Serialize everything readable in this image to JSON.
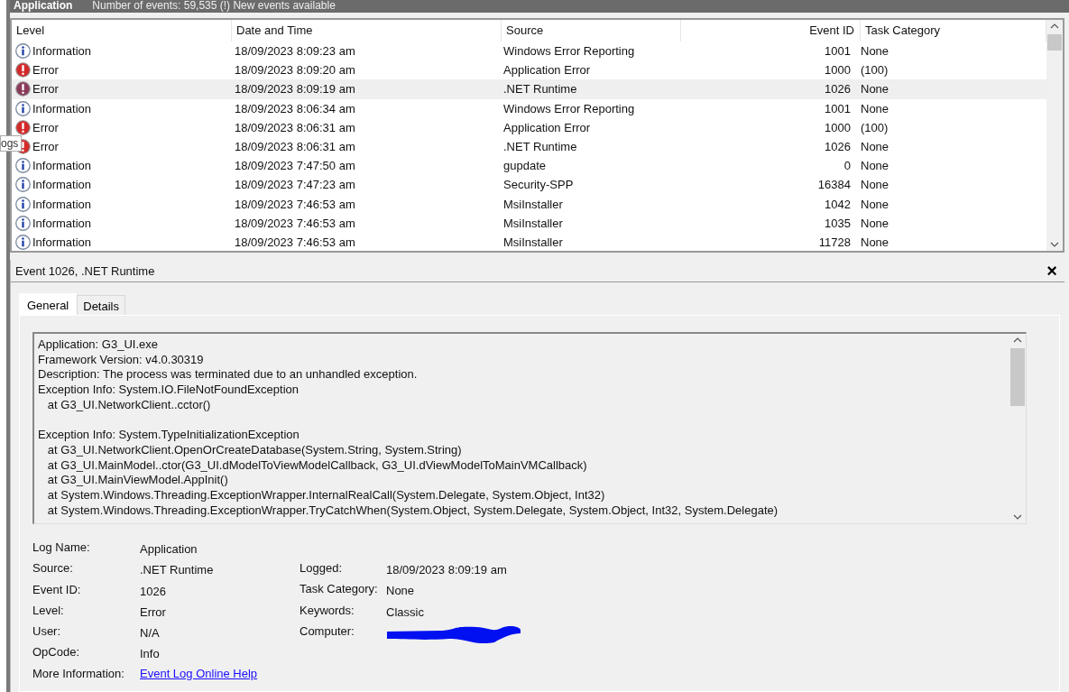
{
  "header": {
    "title": "Application",
    "info": "Number of events: 59,535 (!) New events available"
  },
  "tooltip": {
    "text": "ogs"
  },
  "table": {
    "columns": [
      "Level",
      "Date and Time",
      "Source",
      "Event ID",
      "Task Category"
    ],
    "rows": [
      {
        "kind": "information",
        "level": "Information",
        "date": "18/09/2023 8:09:23 am",
        "source": "Windows Error Reporting",
        "event_id": "1001",
        "task_category": "None",
        "selected": false
      },
      {
        "kind": "error",
        "level": "Error",
        "date": "18/09/2023 8:09:20 am",
        "source": "Application Error",
        "event_id": "1000",
        "task_category": "(100)",
        "selected": false
      },
      {
        "kind": "error",
        "level": "Error",
        "date": "18/09/2023 8:09:19 am",
        "source": ".NET Runtime",
        "event_id": "1026",
        "task_category": "None",
        "selected": true
      },
      {
        "kind": "information",
        "level": "Information",
        "date": "18/09/2023 8:06:34 am",
        "source": "Windows Error Reporting",
        "event_id": "1001",
        "task_category": "None",
        "selected": false
      },
      {
        "kind": "error",
        "level": "Error",
        "date": "18/09/2023 8:06:31 am",
        "source": "Application Error",
        "event_id": "1000",
        "task_category": "(100)",
        "selected": false
      },
      {
        "kind": "error",
        "level": "Error",
        "date": "18/09/2023 8:06:31 am",
        "source": ".NET Runtime",
        "event_id": "1026",
        "task_category": "None",
        "selected": false
      },
      {
        "kind": "information",
        "level": "Information",
        "date": "18/09/2023 7:47:50 am",
        "source": "gupdate",
        "event_id": "0",
        "task_category": "None",
        "selected": false
      },
      {
        "kind": "information",
        "level": "Information",
        "date": "18/09/2023 7:47:23 am",
        "source": "Security-SPP",
        "event_id": "16384",
        "task_category": "None",
        "selected": false
      },
      {
        "kind": "information",
        "level": "Information",
        "date": "18/09/2023 7:46:53 am",
        "source": "MsiInstaller",
        "event_id": "1042",
        "task_category": "None",
        "selected": false
      },
      {
        "kind": "information",
        "level": "Information",
        "date": "18/09/2023 7:46:53 am",
        "source": "MsiInstaller",
        "event_id": "1035",
        "task_category": "None",
        "selected": false
      },
      {
        "kind": "information",
        "level": "Information",
        "date": "18/09/2023 7:46:53 am",
        "source": "MsiInstaller",
        "event_id": "11728",
        "task_category": "None",
        "selected": false
      }
    ]
  },
  "detail": {
    "title": "Event 1026, .NET Runtime",
    "close": "×",
    "tabs": [
      {
        "label": "General",
        "selected": true
      },
      {
        "label": "Details",
        "selected": false
      }
    ],
    "description": [
      [
        "Application: G3_UI.exe",
        "Framework Version: v4.0.30319",
        "Description: The process was terminated due to an unhandled exception.",
        "Exception Info: System.IO.FileNotFoundException",
        "   at G3_UI.NetworkClient..cctor()"
      ],
      [
        "Exception Info: System.TypeInitializationException",
        "   at G3_UI.NetworkClient.OpenOrCreateDatabase(System.String, System.String)",
        "   at G3_UI.MainModel..ctor(G3_UI.dModelToViewModelCallback, G3_UI.dViewModelToMainVMCallback)",
        "   at G3_UI.MainViewModel.AppInit()",
        "   at System.Windows.Threading.ExceptionWrapper.InternalRealCall(System.Delegate, System.Object, Int32)",
        "   at System.Windows.Threading.ExceptionWrapper.TryCatchWhen(System.Object, System.Delegate, System.Object, Int32, System.Delegate)"
      ]
    ],
    "left_properties": [
      {
        "label": "Log Name:",
        "value": "Application"
      },
      {
        "label": "Source:",
        "value": ".NET Runtime"
      },
      {
        "label": "Event ID:",
        "value": "1026"
      },
      {
        "label": "Level:",
        "value": "Error"
      },
      {
        "label": "User:",
        "value": "N/A"
      },
      {
        "label": "OpCode:",
        "value": "Info"
      }
    ],
    "right_properties": [
      {
        "label": "Logged:",
        "value": "18/09/2023 8:09:19 am",
        "kind": "text"
      },
      {
        "label": "Task Category:",
        "value": "None",
        "kind": "text"
      },
      {
        "label": "Keywords:",
        "value": "Classic",
        "kind": "text"
      },
      {
        "label": "Computer:",
        "kind": "redacted"
      }
    ],
    "more_information": {
      "label": "More Information:",
      "link": "Event Log Online Help"
    }
  }
}
